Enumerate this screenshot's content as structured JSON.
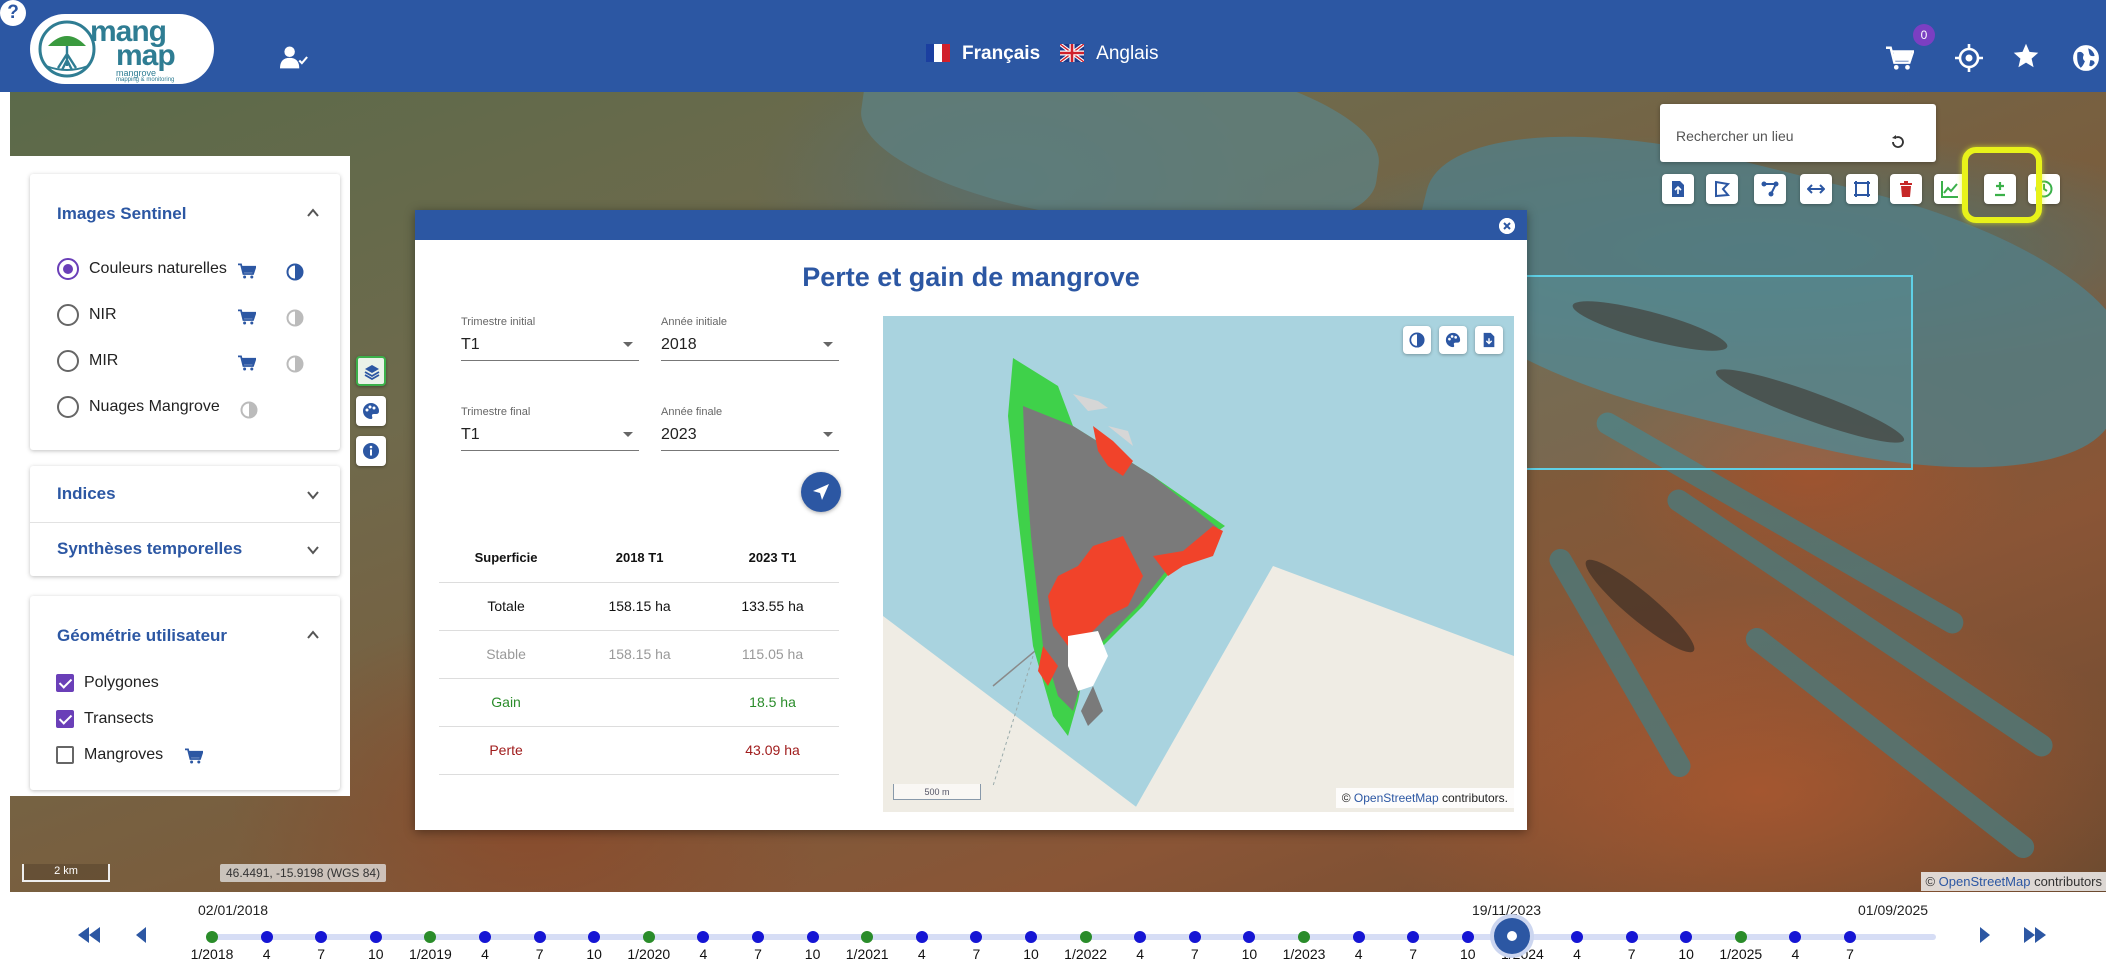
{
  "header": {
    "logo_line1": "mang",
    "logo_line2": "map",
    "logo_sub1": "mangrove",
    "logo_sub2": "mapping & monitoring",
    "help_label": "?",
    "lang_fr": "Français",
    "lang_en": "Anglais",
    "cart_count": "0"
  },
  "sidebar": {
    "sentinel": {
      "title": "Images Sentinel",
      "options": [
        {
          "label": "Couleurs naturelles",
          "selected": true
        },
        {
          "label": "NIR",
          "selected": false
        },
        {
          "label": "MIR",
          "selected": false
        },
        {
          "label": "Nuages Mangrove",
          "selected": false
        }
      ]
    },
    "indices_title": "Indices",
    "syntheses_title": "Synthèses temporelles",
    "geometry": {
      "title": "Géométrie utilisateur",
      "items": [
        {
          "label": "Polygones",
          "checked": true
        },
        {
          "label": "Transects",
          "checked": true
        },
        {
          "label": "Mangroves",
          "checked": false
        }
      ]
    }
  },
  "search": {
    "placeholder": "Rechercher un lieu"
  },
  "dialog": {
    "title": "Perte et gain de mangrove",
    "start_quarter_label": "Trimestre initial",
    "start_quarter": "T1",
    "start_year_label": "Année initiale",
    "start_year": "2018",
    "end_quarter_label": "Trimestre final",
    "end_quarter": "T1",
    "end_year_label": "Année finale",
    "end_year": "2023",
    "table": {
      "headers": [
        "Superficie",
        "2018 T1",
        "2023 T1"
      ],
      "rows": [
        [
          "Totale",
          "158.15 ha",
          "133.55 ha"
        ],
        [
          "Stable",
          "158.15 ha",
          "115.05 ha"
        ],
        [
          "Gain",
          "",
          "18.5 ha"
        ],
        [
          "Perte",
          "",
          "43.09 ha"
        ]
      ]
    },
    "mini_scale": "500 m",
    "attr_prefix": "©",
    "attr_link": "OpenStreetMap",
    "attr_suffix": "contributors."
  },
  "map": {
    "scale": "2 km",
    "coords": "46.4491, -15.9198 (WGS 84)",
    "attr_prefix": "©",
    "attr_link": "OpenStreetMap",
    "attr_suffix": "contributors"
  },
  "timeline": {
    "start_date": "02/01/2018",
    "current_date": "19/11/2023",
    "end_date": "01/09/2025",
    "ticks": [
      "1/2018",
      "4",
      "7",
      "10",
      "1/2019",
      "4",
      "7",
      "10",
      "1/2020",
      "4",
      "7",
      "10",
      "1/2021",
      "4",
      "7",
      "10",
      "1/2022",
      "4",
      "7",
      "10",
      "1/2023",
      "4",
      "7",
      "10",
      "1/2024",
      "4",
      "7",
      "10",
      "1/2025",
      "4",
      "7"
    ]
  },
  "colors": {
    "primary": "#2c57a3",
    "accent_purple": "#6a3fb8",
    "gain_green": "#2a8c2a",
    "loss_red": "#a01c1c",
    "highlight_yellow": "#e8f21a"
  }
}
